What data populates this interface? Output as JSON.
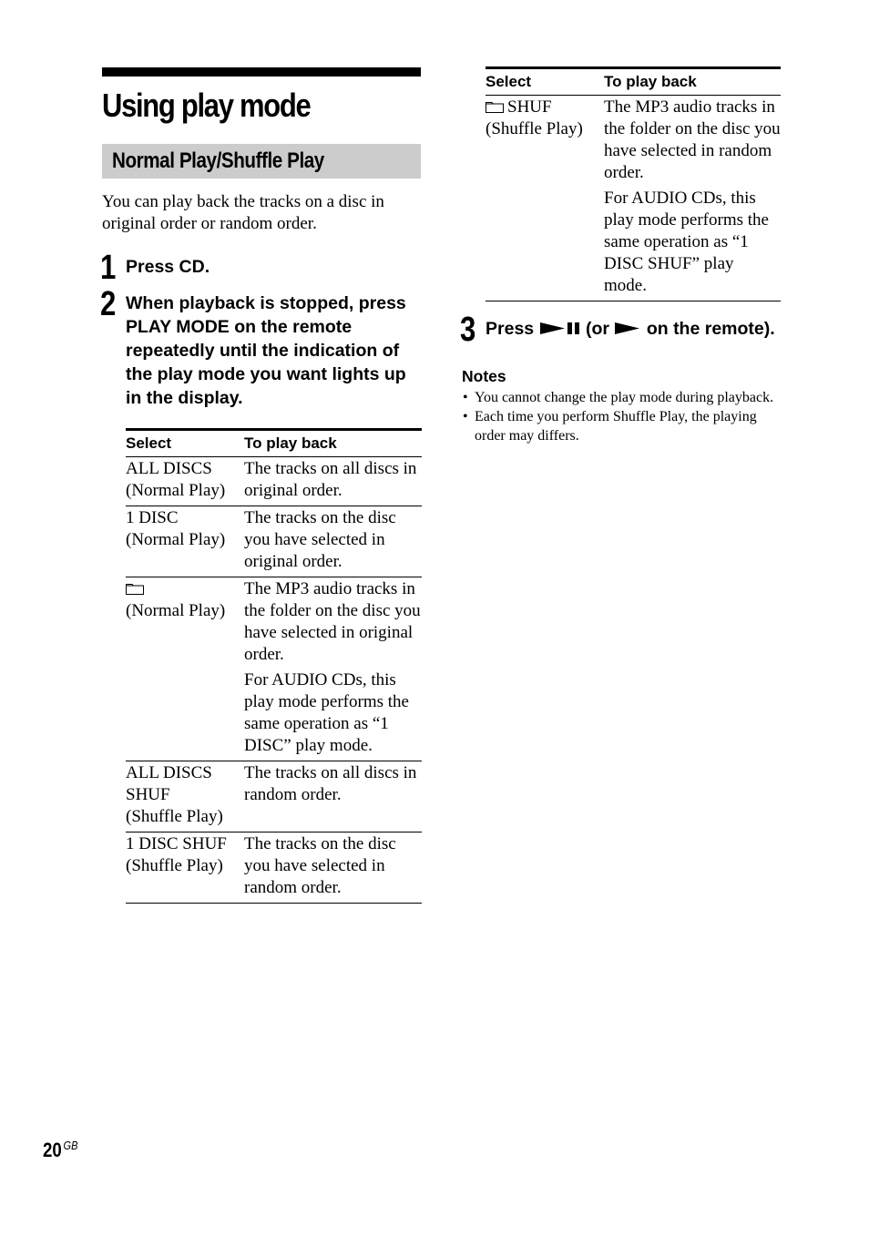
{
  "page": {
    "title": "Using play mode",
    "section_title": "Normal Play/Shuffle Play",
    "intro": "You can play back the tracks on a disc in original order or random order.",
    "page_number": "20",
    "page_suffix": "GB"
  },
  "steps": [
    {
      "number": "1",
      "text": "Press CD."
    },
    {
      "number": "2",
      "text": "When playback is stopped, press PLAY MODE on the remote repeatedly until the indication of the play mode you want lights up in the display."
    },
    {
      "number": "3",
      "text_before": "Press",
      "text_middle": "(or",
      "text_after": "on the remote).",
      "icons": [
        "play-pause-icon",
        "play-icon"
      ]
    }
  ],
  "table": {
    "headers": {
      "select": "Select",
      "play_back": "To play back"
    },
    "rows": [
      {
        "select_line1": "ALL DISCS",
        "select_line2": "(Normal Play)",
        "desc": "The tracks on all discs in original order.",
        "desc2": null,
        "icon": null
      },
      {
        "select_line1": "1 DISC",
        "select_line2": "(Normal Play)",
        "desc": "The tracks on the disc you have selected in original order.",
        "desc2": null,
        "icon": null
      },
      {
        "select_line1": "",
        "select_line2": "(Normal Play)",
        "desc": "The MP3 audio tracks in the folder on the disc you have selected in original order.",
        "desc2": "For AUDIO CDs, this play mode performs the same operation as “1 DISC” play mode.",
        "icon": "folder-icon"
      },
      {
        "select_line1": "ALL DISCS SHUF",
        "select_line2": "(Shuffle Play)",
        "desc": "The tracks on all discs in random order.",
        "desc2": null,
        "icon": null
      },
      {
        "select_line1": "1 DISC SHUF",
        "select_line2": "(Shuffle Play)",
        "desc": "The tracks on the disc you have selected in random order.",
        "desc2": null,
        "icon": null
      },
      {
        "select_line1": "SHUF",
        "select_line2": "(Shuffle Play)",
        "desc": "The MP3 audio tracks in the folder on the disc you have selected in random order.",
        "desc2": "For AUDIO CDs, this play mode performs the same operation as “1 DISC SHUF” play mode.",
        "icon": "folder-icon"
      }
    ]
  },
  "notes": {
    "title": "Notes",
    "items": [
      "You cannot change the play mode during playback.",
      "Each time you perform Shuffle Play, the playing order may differs."
    ]
  }
}
